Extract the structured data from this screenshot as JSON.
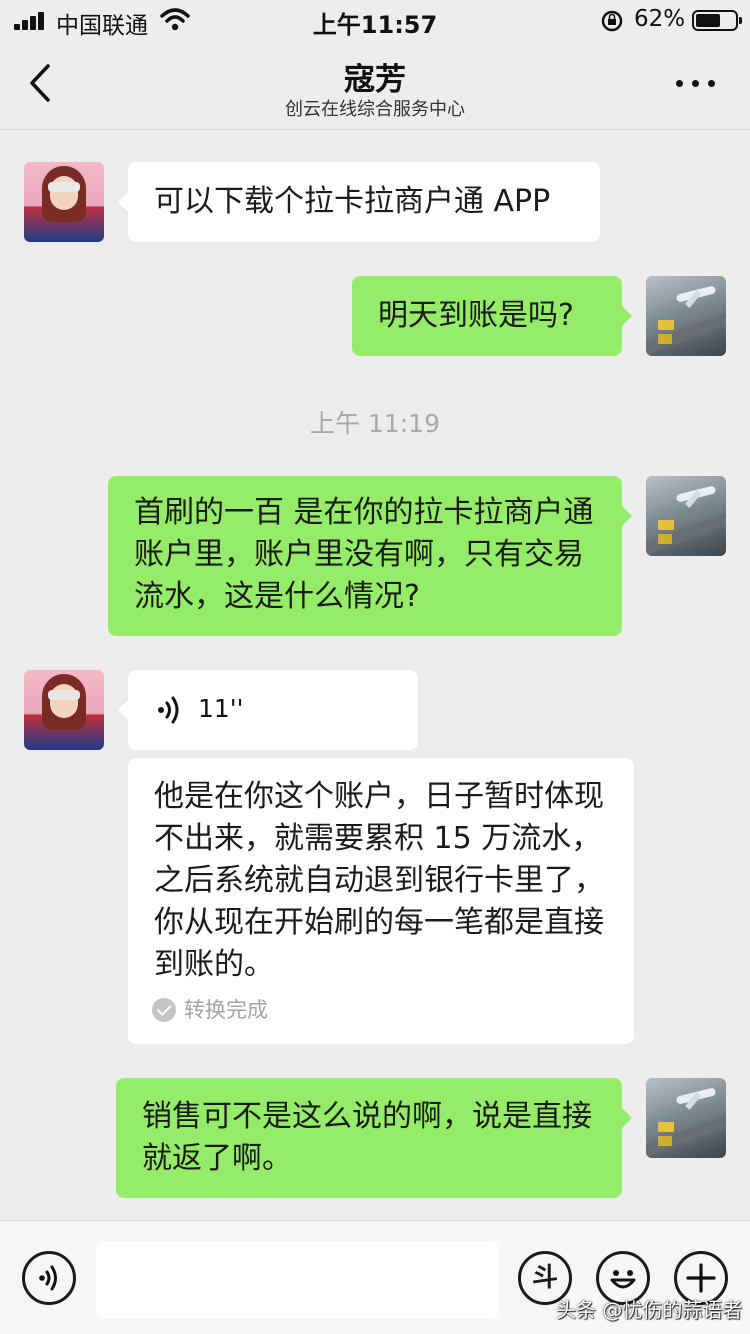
{
  "status_bar": {
    "carrier": "中国联通",
    "time": "上午11:57",
    "battery_pct": "62%",
    "battery_level": 0.62
  },
  "nav": {
    "title": "寇芳",
    "subtitle": "创云在线综合服务中心",
    "back_icon": "chevron-left-icon",
    "more_icon": "more-horizontal-icon"
  },
  "messages": [
    {
      "side": "left",
      "text": "可以下载个拉卡拉商户通 APP"
    },
    {
      "side": "right",
      "text": "明天到账是吗?"
    },
    {
      "side": "right",
      "text": "首刷的一百 是在你的拉卡拉商户通账户里，账户里没有啊，只有交易流水，这是什么情况?"
    },
    {
      "side": "left",
      "type": "voice",
      "duration": "11''"
    },
    {
      "side": "left",
      "type": "transcription",
      "text": "他是在你这个账户，日子暂时体现不出来，就需要累积 15 万流水，之后系统就自动退到银行卡里了，你从现在开始刷的每一笔都是直接到账的。",
      "status": "转换完成"
    },
    {
      "side": "right",
      "text": "销售可不是这么说的啊，说是直接就返了啊。"
    }
  ],
  "timestamp": "上午 11:19",
  "input_bar": {
    "voice_icon": "voice-icon",
    "dou_label": "斗",
    "emoji_icon": "emoji-icon",
    "plus_icon": "plus-icon"
  },
  "watermark": "头条 @忧伤的蒜语者",
  "colors": {
    "background": "#ededed",
    "bubble_right": "#95ec69",
    "bubble_left": "#ffffff",
    "timestamp": "#a8a8a8"
  }
}
